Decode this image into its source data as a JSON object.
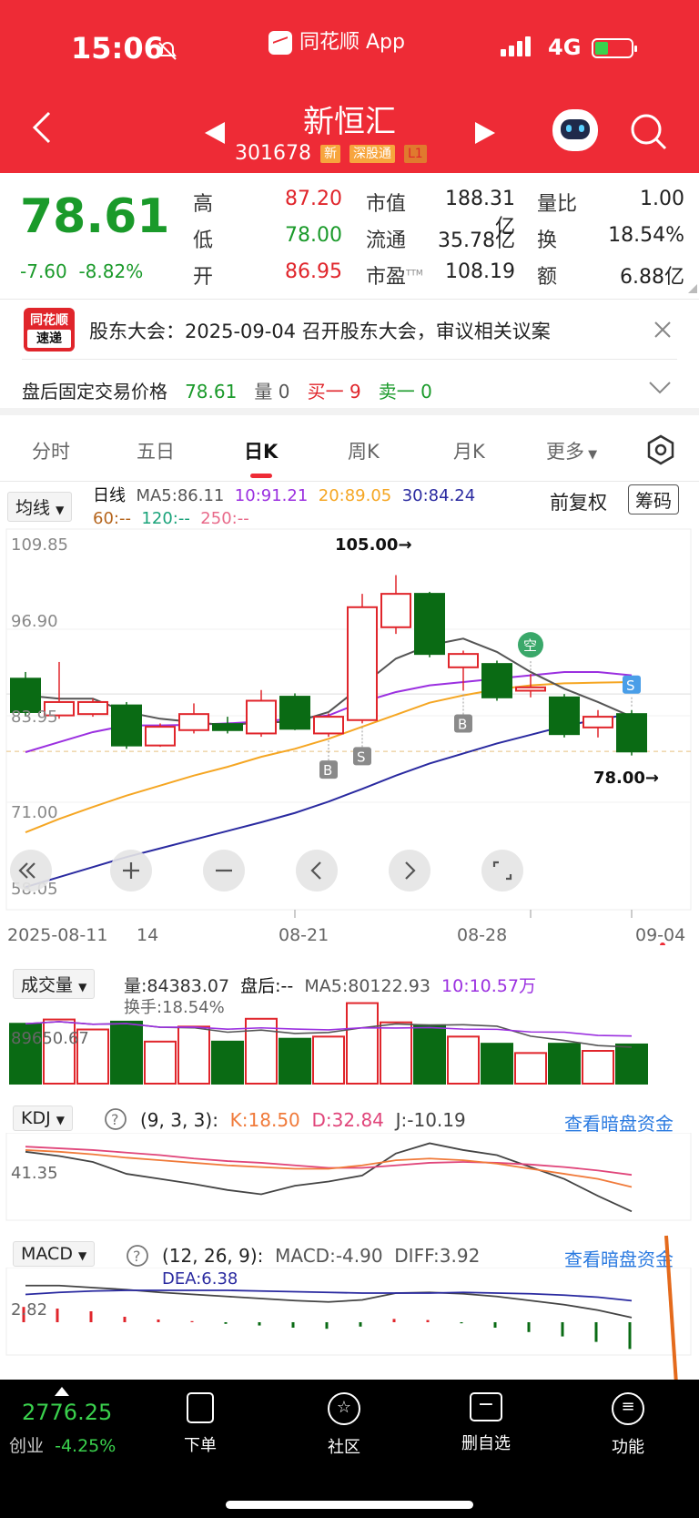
{
  "status_bar": {
    "time": "15:06",
    "app": "同花顺 App",
    "network": "4G"
  },
  "header": {
    "title": "新恒汇",
    "code": "301678",
    "tags": [
      "新",
      "深股通",
      "L1"
    ]
  },
  "quote": {
    "price": "78.61",
    "change": "-7.60",
    "change_pct": "-8.82%",
    "rows": [
      {
        "l1": "高",
        "v1": "87.20",
        "l2": "市值",
        "v2": "188.31亿",
        "l3": "量比",
        "v3": "1.00"
      },
      {
        "l1": "低",
        "v1": "78.00",
        "l2": "流通",
        "v2": "35.78亿",
        "l3": "换",
        "v3": "18.54%"
      },
      {
        "l1": "开",
        "v1": "86.95",
        "l2": "市盈",
        "l2sup": "TTM",
        "v2": "108.19",
        "l3": "额",
        "v3": "6.88亿"
      }
    ]
  },
  "notice": {
    "logo_top": "同花顺",
    "logo_bottom": "速递",
    "text": "股东大会：2025-09-04 召开股东大会，审议相关议案"
  },
  "after_hours": {
    "label": "盘后固定交易价格",
    "price": "78.61",
    "vol": "量 0",
    "buy": "买一 9",
    "sell": "卖一 0"
  },
  "tabs": [
    "分时",
    "五日",
    "日K",
    "周K",
    "月K",
    "更多"
  ],
  "ma_bar": {
    "dropdown": "均线",
    "period": "日线",
    "ma5": "MA5:86.11",
    "ma10": "10:91.21",
    "ma20": "20:89.05",
    "ma30": "30:84.24",
    "ma60": "60:--",
    "ma120": "120:--",
    "ma250": "250:--",
    "adjust": "前复权",
    "chip": "筹码"
  },
  "colors": {
    "up": "#e0252b",
    "down": "#0a6b14",
    "ma5": "#555555",
    "ma10": "#9b30e0",
    "ma20": "#f5a623",
    "ma30": "#2a2aa0"
  },
  "chart_data": [
    {
      "type": "candlestick",
      "y_ticks": [
        "109.85",
        "96.90",
        "83.95",
        "71.00",
        "58.05"
      ],
      "ylim": [
        58.05,
        109.85
      ],
      "x_labels": [
        "2025-08-11",
        "14",
        "08-21",
        "08-28",
        "09-04"
      ],
      "annotations": {
        "high": "105.00→",
        "low": "78.00→"
      },
      "markers": [
        "B",
        "S",
        "B",
        "空",
        "S"
      ],
      "candles": [
        {
          "o": 89.5,
          "c": 84.5,
          "h": 90.5,
          "l": 84.0
        },
        {
          "o": 84.0,
          "c": 86.0,
          "h": 92.0,
          "l": 83.5
        },
        {
          "o": 84.2,
          "c": 86.0,
          "h": 86.5,
          "l": 83.8
        },
        {
          "o": 85.5,
          "c": 79.5,
          "h": 86.0,
          "l": 79.0
        },
        {
          "o": 79.5,
          "c": 82.3,
          "h": 82.8,
          "l": 79.3
        },
        {
          "o": 81.8,
          "c": 84.2,
          "h": 85.8,
          "l": 81.3
        },
        {
          "o": 82.7,
          "c": 81.8,
          "h": 83.8,
          "l": 81.3
        },
        {
          "o": 81.3,
          "c": 86.2,
          "h": 87.8,
          "l": 80.8
        },
        {
          "o": 86.8,
          "c": 82.0,
          "h": 87.3,
          "l": 81.8
        },
        {
          "o": 81.3,
          "c": 83.8,
          "h": 84.3,
          "l": 80.8
        },
        {
          "o": 83.3,
          "c": 100.2,
          "h": 102.2,
          "l": 82.8
        },
        {
          "o": 97.2,
          "c": 102.2,
          "h": 105.0,
          "l": 96.2
        },
        {
          "o": 102.2,
          "c": 93.2,
          "h": 102.5,
          "l": 92.7
        },
        {
          "o": 91.2,
          "c": 93.2,
          "h": 93.7,
          "l": 87.7
        },
        {
          "o": 91.7,
          "c": 86.7,
          "h": 92.2,
          "l": 86.2
        },
        {
          "o": 87.7,
          "c": 88.2,
          "h": 90.2,
          "l": 86.7
        },
        {
          "o": 86.7,
          "c": 81.2,
          "h": 87.2,
          "l": 80.7
        },
        {
          "o": 82.2,
          "c": 83.8,
          "h": 84.8,
          "l": 80.7
        },
        {
          "o": 84.2,
          "c": 78.6,
          "h": 84.8,
          "l": 78.0
        }
      ],
      "ma5": [
        87.0,
        86.5,
        86.5,
        84.5,
        83.5,
        83.0,
        82.5,
        83.0,
        83.0,
        84.5,
        88.5,
        92.5,
        94.5,
        95.5,
        93.5,
        90.5,
        88.0,
        86.0,
        83.8
      ],
      "ma10": [
        78.5,
        80.0,
        81.5,
        82.5,
        82.5,
        82.6,
        82.8,
        83.1,
        83.5,
        84.0,
        86.0,
        87.5,
        88.5,
        89.0,
        89.5,
        90.0,
        90.5,
        90.5,
        90.0
      ],
      "ma20": [
        66.5,
        68.5,
        70.3,
        72.0,
        73.5,
        75.0,
        76.3,
        77.8,
        79.0,
        80.5,
        82.3,
        84.1,
        85.9,
        87.0,
        87.9,
        88.5,
        88.8,
        88.9,
        89.0
      ],
      "ma30": [
        58.3,
        59.8,
        61.3,
        62.8,
        64.1,
        65.4,
        66.7,
        68.0,
        69.4,
        71.1,
        73.0,
        75.0,
        76.8,
        78.3,
        79.8,
        81.1,
        82.4,
        83.4,
        84.2
      ]
    },
    {
      "type": "bar",
      "title": "成交量",
      "labels": {
        "vol": "量:84383.07",
        "after": "盘后:--",
        "ma5": "MA5:80122.93",
        "ma10": "10:10.57万",
        "turnover": "换手:18.54%",
        "axis": "89650.67"
      },
      "values": [
        84000,
        90000,
        76000,
        87000,
        59000,
        80000,
        59000,
        91000,
        63000,
        66000,
        113000,
        86000,
        82000,
        66000,
        56000,
        43000,
        56000,
        46000,
        55000
      ]
    },
    {
      "type": "line",
      "title": "KDJ",
      "params": "(9, 3, 3):",
      "labels": {
        "k": "K:18.50",
        "d": "D:32.84",
        "j": "J:-10.19",
        "axis": "41.35"
      },
      "k": [
        62,
        60,
        57,
        53,
        50,
        47,
        44,
        42,
        40,
        40,
        44,
        50,
        52,
        50,
        46,
        40,
        34,
        28,
        18.5
      ],
      "d": [
        66,
        64,
        62,
        59,
        56,
        52,
        49,
        47,
        44,
        41,
        41,
        44,
        47,
        48,
        47,
        45,
        42,
        38,
        32.8
      ],
      "j": [
        60,
        55,
        48,
        34,
        28,
        22,
        15,
        10,
        20,
        25,
        32,
        58,
        70,
        62,
        56,
        42,
        28,
        8,
        -10.19
      ]
    },
    {
      "type": "bar",
      "title": "MACD",
      "params": "(12, 26, 9):",
      "labels": {
        "macd": "MACD:-4.90",
        "diff": "DIFF:3.92",
        "dea": "DEA:6.38",
        "axis": "2.82"
      },
      "macd": [
        2.8,
        2.5,
        2.0,
        1.0,
        0.5,
        0.2,
        -0.3,
        -0.6,
        -1.0,
        -1.2,
        -0.8,
        0.6,
        0.4,
        -0.2,
        -1.0,
        -1.8,
        -2.6,
        -3.6,
        -4.9
      ],
      "diff": [
        8.6,
        8.6,
        8.3,
        8.0,
        7.6,
        7.3,
        7.0,
        6.7,
        6.4,
        6.2,
        6.5,
        7.5,
        7.6,
        7.4,
        7.0,
        6.4,
        5.8,
        5.0,
        3.92
      ],
      "dea": [
        7.3,
        7.6,
        7.8,
        7.9,
        7.9,
        7.9,
        7.9,
        7.8,
        7.7,
        7.6,
        7.5,
        7.5,
        7.5,
        7.6,
        7.5,
        7.4,
        7.2,
        6.9,
        6.38
      ]
    }
  ],
  "dark_pool": "查看暗盘资金",
  "bottom_bar": {
    "index_value": "2776.25",
    "index_name": "创业",
    "index_chg": "-4.25%",
    "items": [
      "下单",
      "社区",
      "删自选",
      "功能"
    ]
  }
}
